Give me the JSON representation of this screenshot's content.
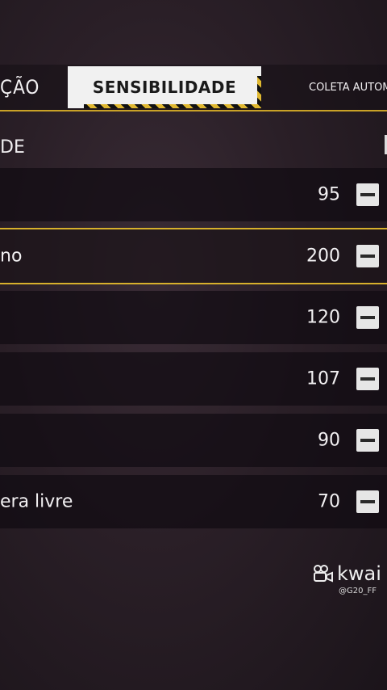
{
  "tabs": {
    "left_partial": "ÇÃO",
    "active": "SENSIBILIDADE",
    "right_partial": "COLETA AUTOMA"
  },
  "section": {
    "label": "DE"
  },
  "rows": [
    {
      "label": "",
      "value": "95"
    },
    {
      "label": "no",
      "value": "200"
    },
    {
      "label": "",
      "value": "120"
    },
    {
      "label": "",
      "value": "107"
    },
    {
      "label": "",
      "value": "90"
    },
    {
      "label": "era livre",
      "value": "70"
    }
  ],
  "watermark": {
    "brand": "kwai",
    "handle": "@G20_FF",
    "icon": "kwai-logo-icon"
  },
  "colors": {
    "accent": "#d7b02c",
    "active_tab_bg": "#f1f1f1"
  }
}
